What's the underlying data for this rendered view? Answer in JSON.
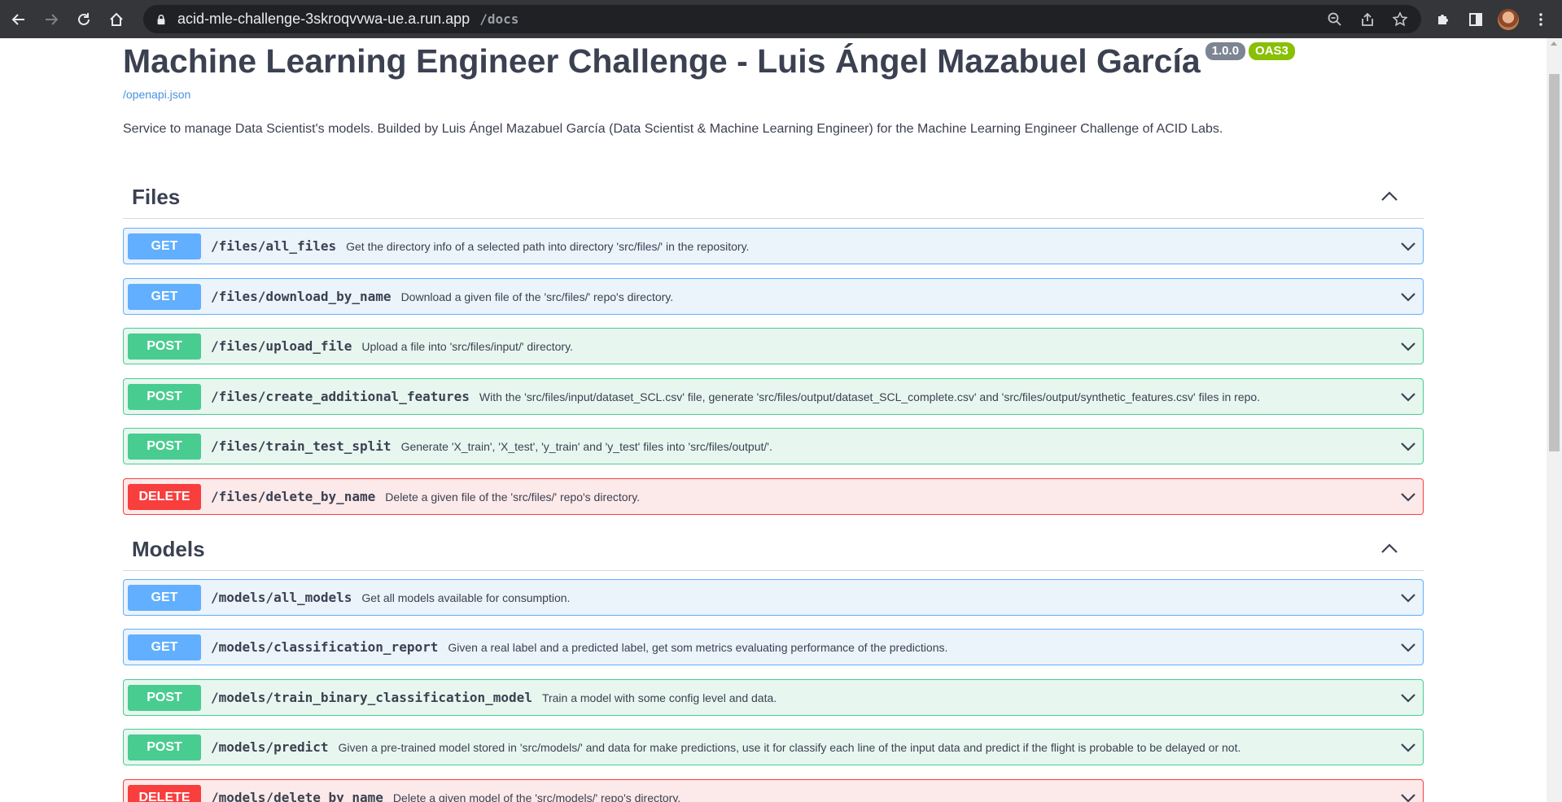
{
  "browser": {
    "url_host": "acid-mle-challenge-3skroqvvwa-ue.a.run.app",
    "url_path": "/docs"
  },
  "info": {
    "title": "Machine Learning Engineer Challenge - Luis Ángel Mazabuel García",
    "version": "1.0.0",
    "oas": "OAS3",
    "openapi_link": "/openapi.json",
    "description": "Service to manage Data Scientist's models. Builded by Luis Ángel Mazabuel García (Data Scientist & Machine Learning Engineer) for the Machine Learning Engineer Challenge of ACID Labs."
  },
  "tags": [
    {
      "name": "Files",
      "operations": [
        {
          "method": "GET",
          "path": "/files/all_files",
          "summary": "Get the directory info of a selected path into directory 'src/files/' in the repository."
        },
        {
          "method": "GET",
          "path": "/files/download_by_name",
          "summary": "Download a given file of the 'src/files/' repo's directory."
        },
        {
          "method": "POST",
          "path": "/files/upload_file",
          "summary": "Upload a file into 'src/files/input/' directory."
        },
        {
          "method": "POST",
          "path": "/files/create_additional_features",
          "summary": "With the 'src/files/input/dataset_SCL.csv' file, generate 'src/files/output/dataset_SCL_complete.csv' and 'src/files/output/synthetic_features.csv' files in repo."
        },
        {
          "method": "POST",
          "path": "/files/train_test_split",
          "summary": "Generate 'X_train', 'X_test', 'y_train' and 'y_test' files into 'src/files/output/'."
        },
        {
          "method": "DELETE",
          "path": "/files/delete_by_name",
          "summary": "Delete a given file of the 'src/files/' repo's directory."
        }
      ]
    },
    {
      "name": "Models",
      "operations": [
        {
          "method": "GET",
          "path": "/models/all_models",
          "summary": "Get all models available for consumption."
        },
        {
          "method": "GET",
          "path": "/models/classification_report",
          "summary": "Given a real label and a predicted label, get som metrics evaluating performance of the predictions."
        },
        {
          "method": "POST",
          "path": "/models/train_binary_classification_model",
          "summary": "Train a model with some config level and data."
        },
        {
          "method": "POST",
          "path": "/models/predict",
          "summary": "Given a pre-trained model stored in 'src/models/' and data for make predictions, use it for classify each line of the input data and predict if the flight is probable to be delayed or not."
        },
        {
          "method": "DELETE",
          "path": "/models/delete_by_name",
          "summary": "Delete a given model of the 'src/models/' repo's directory."
        }
      ]
    }
  ]
}
